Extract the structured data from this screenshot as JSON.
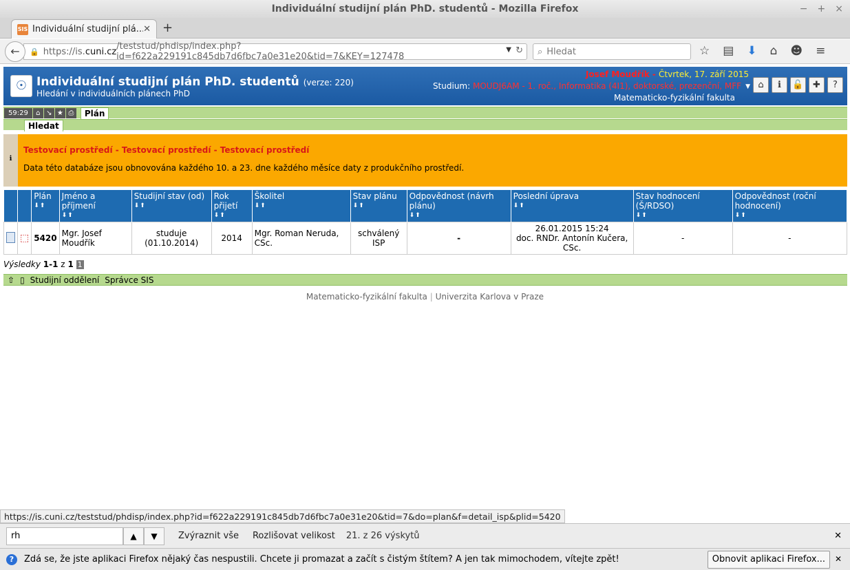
{
  "window": {
    "title": "Individuální studijní plán PhD. studentů - Mozilla Firefox"
  },
  "tab": {
    "favicon": "SIS",
    "title": "Individuální studijní plá..."
  },
  "nav": {
    "url_prefix": "https://is.",
    "url_domain": "cuni.cz",
    "url_rest": "/teststud/phdisp/index.php?id=f622a229191c845db7d6fbc7a0e31e20&tid=7&KEY=127478",
    "search_placeholder": "Hledat"
  },
  "header": {
    "title": "Individuální studijní plán PhD. studentů",
    "version": "(verze: 220)",
    "subtitle": "Hledání v individuálních plánech PhD",
    "user": "Josef Moudřík",
    "date": "Čtvrtek, 17. září 2015",
    "studium_label": "Studium:",
    "studium_value": "MOUDJ6AM - 1. roč., Informatika (4I1), doktorské, prezenční, MFF",
    "faculty": "Matematicko-fyzikální fakulta"
  },
  "menu": {
    "timer": "59:29",
    "tab_plan": "Plán",
    "tab_search": "Hledat"
  },
  "warning": {
    "title": "Testovací prostředí - Testovací prostředí - Testovací prostředí",
    "text": "Data této databáze jsou obnovována každého 10. a 23. dne každého měsíce daty z produkčního prostředí."
  },
  "table": {
    "headers": [
      "Plán",
      "Jméno a příjmení",
      "Studijní stav (od)",
      "Rok přijetí",
      "Školitel",
      "Stav plánu",
      "Odpovědnost (návrh plánu)",
      "Poslední úprava",
      "Stav hodnocení (Š/RDSO)",
      "Odpovědnost (roční hodnocení)"
    ],
    "row": {
      "plan": "5420",
      "name": "Mgr. Josef Moudřík",
      "status": "studuje (01.10.2014)",
      "year": "2014",
      "supervisor": "Mgr. Roman Neruda, CSc.",
      "plan_state": "schválený ISP",
      "resp_plan": "-",
      "last_edit_date": "26.01.2015 15:24",
      "last_edit_by": "doc. RNDr. Antonín Kučera, CSc.",
      "eval_state": "-",
      "resp_eval": "-"
    }
  },
  "results": {
    "label": "Výsledky",
    "range": "1-1",
    "of": "z",
    "total": "1",
    "page": "1"
  },
  "footbar": {
    "link1": "Studijní oddělení",
    "link2": "Správce SIS"
  },
  "footer": {
    "faculty": "Matematicko-fyzikální fakulta",
    "sep": "|",
    "university": "Univerzita Karlova v Praze"
  },
  "statusbar": {
    "url": "https://is.cuni.cz/teststud/phdisp/index.php?id=f622a229191c845db7d6fbc7a0e31e20&tid=7&do=plan&f=detail_isp&plid=5420"
  },
  "findbar": {
    "value": "rh",
    "highlight": "Zvýraznit vše",
    "match_case": "Rozlišovat velikost",
    "count": "21. z 26 výskytů"
  },
  "notification": {
    "text": "Zdá se, že jste aplikaci Firefox nějaký čas nespustili. Chcete ji promazat a začít s čistým štítem? A jen tak mimochodem, vítejte zpět!",
    "button": "Obnovit aplikaci Firefox..."
  }
}
